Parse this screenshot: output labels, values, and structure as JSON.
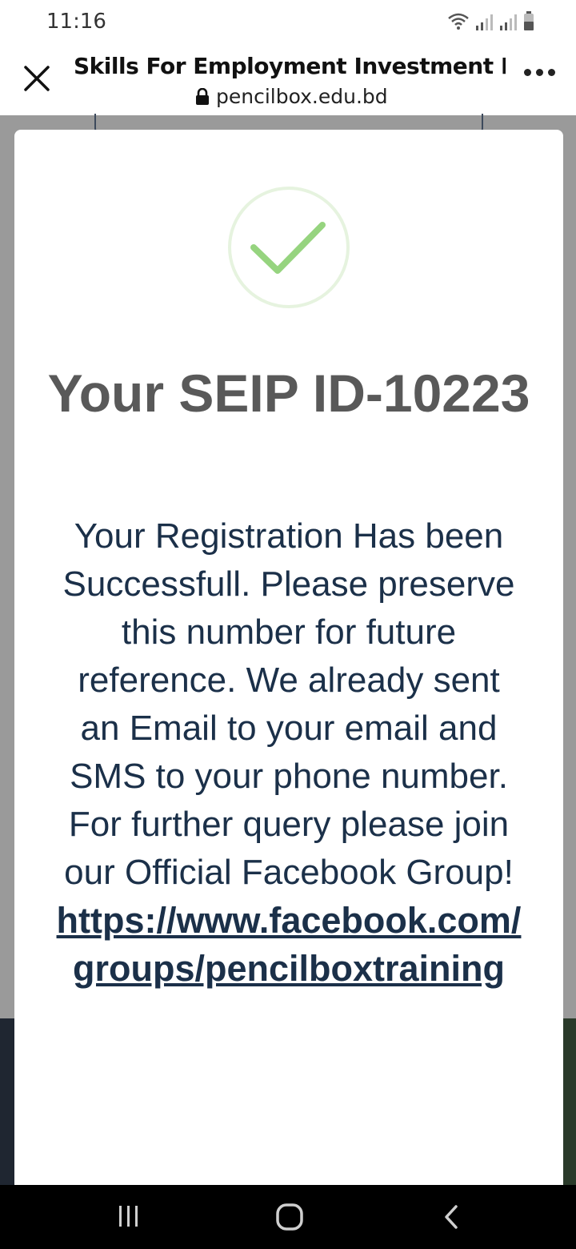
{
  "status_bar": {
    "time": "11:16",
    "icons": [
      "wifi-icon",
      "signal-icon",
      "signal-icon",
      "battery-icon"
    ]
  },
  "browser": {
    "page_title": "Skills For Employment Investment Pro...",
    "url": "pencilbox.edu.bd",
    "close_icon": "close-icon",
    "lock_icon": "lock-icon",
    "more_icon": "more-options-icon"
  },
  "modal": {
    "icon": "checkmark-icon",
    "icon_color": "#96d47f",
    "title": "Your SEIP ID-10223",
    "message": "Your Registration Has been Successfull. Please preserve this number for future reference. We already sent an Email to your email and SMS to your phone number.",
    "query_text": "For further query please join our Official Facebook Group!",
    "link": "https://www.facebook.com/groups/pencilboxtraining"
  },
  "nav_bar": {
    "buttons": [
      "recents-icon",
      "home-icon",
      "back-icon"
    ]
  }
}
